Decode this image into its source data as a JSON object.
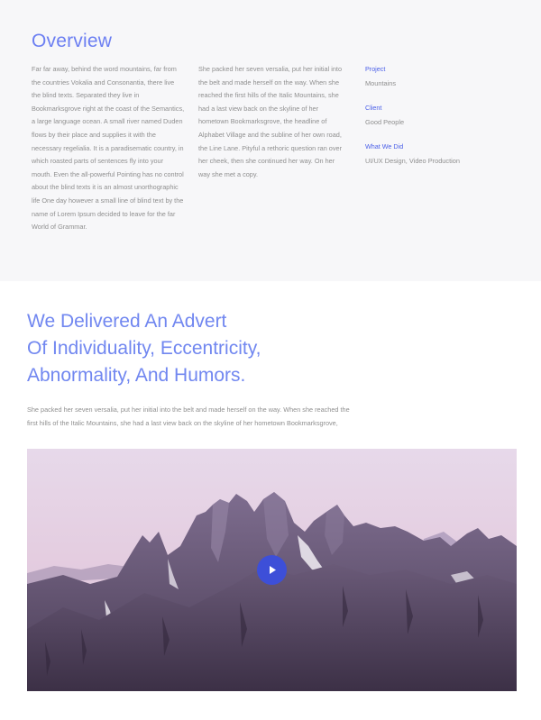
{
  "overview": {
    "title": "Overview",
    "column1": "Far far away, behind the word mountains, far from the countries Vokalia and Consonantia, there live the blind texts. Separated they live in Bookmarksgrove right at the coast of the Semantics, a large language ocean. A small river named Duden flows by their place and supplies it with the necessary regelialia. It is a paradisematic country, in which roasted parts of sentences fly into your mouth. Even the all-powerful Pointing has no control about the blind texts it is an almost unorthographic life One day however a small line of blind text by the name of Lorem Ipsum decided to leave for the far World of Grammar.",
    "column2": "She packed her seven versalia, put her initial into the belt and made herself on the way. When she reached the first hills of the Italic Mountains, she had a last view back on the skyline of her hometown Bookmarksgrove, the headline of Alphabet Village and the subline of her own road, the Line Lane. Pityful a rethoric question ran over her cheek, then she continued her way. On her way she met a copy.",
    "meta": {
      "project_label": "Project",
      "project_value": "Mountains",
      "client_label": "Client",
      "client_value": "Good People",
      "what_label": "What We Did",
      "what_value": "UI/UX Design, Video Production"
    }
  },
  "feature": {
    "headline_line1": "We Delivered An Advert",
    "headline_line2": "Of Individuality, Eccentricity,",
    "headline_line3": "Abnormality, And Humors.",
    "lede": "She packed her seven versalia, put her initial into the belt and made herself on the way. When she reached the first hills of the Italic Mountains, she had a last view back on the skyline of her hometown Bookmarksgrove,"
  },
  "video": {
    "play_icon": "play-icon",
    "accent_color": "#3d4fd8"
  },
  "colors": {
    "accent": "#6c7ff2",
    "link": "#4a5fe8",
    "section_bg": "#f7f7f9",
    "body_text": "#8f8f8f"
  }
}
